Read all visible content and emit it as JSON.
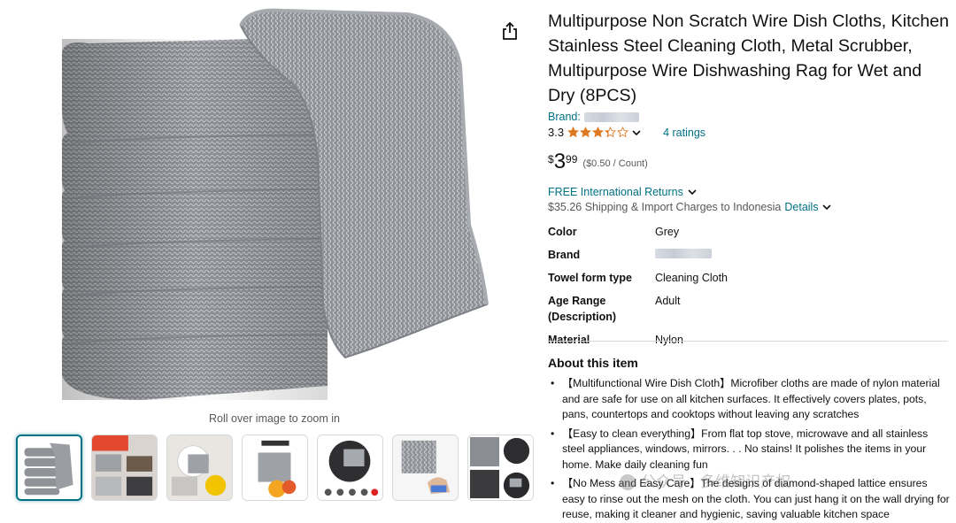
{
  "gallery": {
    "zoom_hint": "Roll over image to zoom in",
    "main_image": "stack-of-grey-wire-dish-cloths",
    "thumbnails": [
      {
        "name": "thumb-stack"
      },
      {
        "name": "thumb-kitchen-use"
      },
      {
        "name": "thumb-plate-wipe"
      },
      {
        "name": "thumb-features"
      },
      {
        "name": "thumb-pan-scrub"
      },
      {
        "name": "thumb-cloth-hand"
      },
      {
        "name": "thumb-collage"
      }
    ],
    "share_icon": "share-icon"
  },
  "product": {
    "title": "Multipurpose Non Scratch Wire Dish Cloths, Kitchen Stainless Steel Cleaning Cloth, Metal Scrubber, Multipurpose Wire Dishwashing Rag for Wet and Dry (8PCS)",
    "brand_label": "Brand:",
    "rating": "3.3",
    "stars_filled": 3.3,
    "ratings_count": "4 ratings",
    "price_symbol": "$",
    "price_whole": "3",
    "price_fraction": "99",
    "price_unit": "($0.50 / Count)",
    "returns": "FREE International Returns",
    "shipping": "$35.26 Shipping & Import Charges to Indonesia",
    "shipping_details": "Details"
  },
  "specs": [
    {
      "key": "Color",
      "value": "Grey"
    },
    {
      "key": "Brand",
      "value": ""
    },
    {
      "key": "Towel form type",
      "value": "Cleaning Cloth"
    },
    {
      "key": "Age Range (Description)",
      "value": "Adult"
    },
    {
      "key": "Material",
      "value": "Nylon"
    }
  ],
  "about": {
    "heading": "About this item",
    "bullets": [
      "【Multifunctional Wire Dish Cloth】Microfiber cloths are made of nylon material and are safe for use on all kitchen surfaces. It effectively covers plates, pots, pans, countertops and cooktops without leaving any scratches",
      "【Easy to clean everything】From flat top stove, microwave and all stainless steel appliances, windows, mirrors. . . No stains! It polishes the items in your home. Make daily cleaning fun",
      "【No Mess and Easy Care】The designs of diamond-shaped lattice ensures easy to rinse out the mesh on the cloth. You can just hang it on the wall drying for reuse, making it cleaner and hygienic, saving valuable kitchen space"
    ]
  },
  "watermark": "公众号 · 多维知识产权",
  "colors": {
    "link": "#007185",
    "star": "#de7921",
    "text": "#0f1111",
    "muted": "#565959"
  }
}
